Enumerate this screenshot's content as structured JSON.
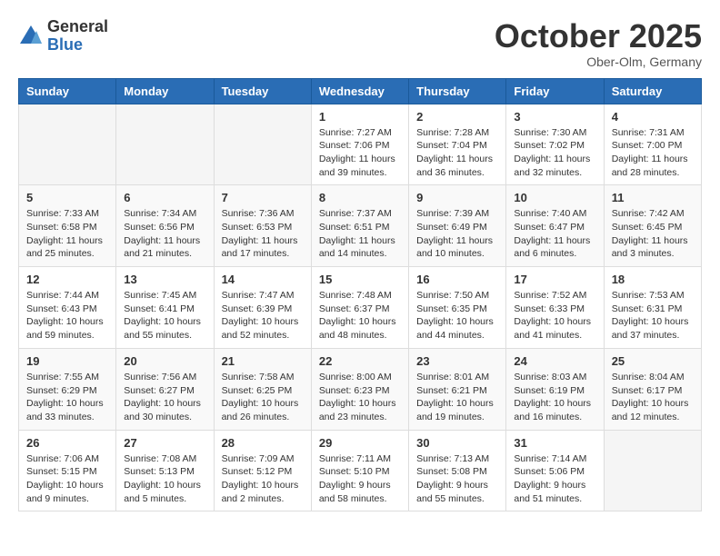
{
  "header": {
    "logo_line1": "General",
    "logo_line2": "Blue",
    "month": "October 2025",
    "location": "Ober-Olm, Germany"
  },
  "weekdays": [
    "Sunday",
    "Monday",
    "Tuesday",
    "Wednesday",
    "Thursday",
    "Friday",
    "Saturday"
  ],
  "weeks": [
    [
      {
        "day": "",
        "info": ""
      },
      {
        "day": "",
        "info": ""
      },
      {
        "day": "",
        "info": ""
      },
      {
        "day": "1",
        "info": "Sunrise: 7:27 AM\nSunset: 7:06 PM\nDaylight: 11 hours\nand 39 minutes."
      },
      {
        "day": "2",
        "info": "Sunrise: 7:28 AM\nSunset: 7:04 PM\nDaylight: 11 hours\nand 36 minutes."
      },
      {
        "day": "3",
        "info": "Sunrise: 7:30 AM\nSunset: 7:02 PM\nDaylight: 11 hours\nand 32 minutes."
      },
      {
        "day": "4",
        "info": "Sunrise: 7:31 AM\nSunset: 7:00 PM\nDaylight: 11 hours\nand 28 minutes."
      }
    ],
    [
      {
        "day": "5",
        "info": "Sunrise: 7:33 AM\nSunset: 6:58 PM\nDaylight: 11 hours\nand 25 minutes."
      },
      {
        "day": "6",
        "info": "Sunrise: 7:34 AM\nSunset: 6:56 PM\nDaylight: 11 hours\nand 21 minutes."
      },
      {
        "day": "7",
        "info": "Sunrise: 7:36 AM\nSunset: 6:53 PM\nDaylight: 11 hours\nand 17 minutes."
      },
      {
        "day": "8",
        "info": "Sunrise: 7:37 AM\nSunset: 6:51 PM\nDaylight: 11 hours\nand 14 minutes."
      },
      {
        "day": "9",
        "info": "Sunrise: 7:39 AM\nSunset: 6:49 PM\nDaylight: 11 hours\nand 10 minutes."
      },
      {
        "day": "10",
        "info": "Sunrise: 7:40 AM\nSunset: 6:47 PM\nDaylight: 11 hours\nand 6 minutes."
      },
      {
        "day": "11",
        "info": "Sunrise: 7:42 AM\nSunset: 6:45 PM\nDaylight: 11 hours\nand 3 minutes."
      }
    ],
    [
      {
        "day": "12",
        "info": "Sunrise: 7:44 AM\nSunset: 6:43 PM\nDaylight: 10 hours\nand 59 minutes."
      },
      {
        "day": "13",
        "info": "Sunrise: 7:45 AM\nSunset: 6:41 PM\nDaylight: 10 hours\nand 55 minutes."
      },
      {
        "day": "14",
        "info": "Sunrise: 7:47 AM\nSunset: 6:39 PM\nDaylight: 10 hours\nand 52 minutes."
      },
      {
        "day": "15",
        "info": "Sunrise: 7:48 AM\nSunset: 6:37 PM\nDaylight: 10 hours\nand 48 minutes."
      },
      {
        "day": "16",
        "info": "Sunrise: 7:50 AM\nSunset: 6:35 PM\nDaylight: 10 hours\nand 44 minutes."
      },
      {
        "day": "17",
        "info": "Sunrise: 7:52 AM\nSunset: 6:33 PM\nDaylight: 10 hours\nand 41 minutes."
      },
      {
        "day": "18",
        "info": "Sunrise: 7:53 AM\nSunset: 6:31 PM\nDaylight: 10 hours\nand 37 minutes."
      }
    ],
    [
      {
        "day": "19",
        "info": "Sunrise: 7:55 AM\nSunset: 6:29 PM\nDaylight: 10 hours\nand 33 minutes."
      },
      {
        "day": "20",
        "info": "Sunrise: 7:56 AM\nSunset: 6:27 PM\nDaylight: 10 hours\nand 30 minutes."
      },
      {
        "day": "21",
        "info": "Sunrise: 7:58 AM\nSunset: 6:25 PM\nDaylight: 10 hours\nand 26 minutes."
      },
      {
        "day": "22",
        "info": "Sunrise: 8:00 AM\nSunset: 6:23 PM\nDaylight: 10 hours\nand 23 minutes."
      },
      {
        "day": "23",
        "info": "Sunrise: 8:01 AM\nSunset: 6:21 PM\nDaylight: 10 hours\nand 19 minutes."
      },
      {
        "day": "24",
        "info": "Sunrise: 8:03 AM\nSunset: 6:19 PM\nDaylight: 10 hours\nand 16 minutes."
      },
      {
        "day": "25",
        "info": "Sunrise: 8:04 AM\nSunset: 6:17 PM\nDaylight: 10 hours\nand 12 minutes."
      }
    ],
    [
      {
        "day": "26",
        "info": "Sunrise: 7:06 AM\nSunset: 5:15 PM\nDaylight: 10 hours\nand 9 minutes."
      },
      {
        "day": "27",
        "info": "Sunrise: 7:08 AM\nSunset: 5:13 PM\nDaylight: 10 hours\nand 5 minutes."
      },
      {
        "day": "28",
        "info": "Sunrise: 7:09 AM\nSunset: 5:12 PM\nDaylight: 10 hours\nand 2 minutes."
      },
      {
        "day": "29",
        "info": "Sunrise: 7:11 AM\nSunset: 5:10 PM\nDaylight: 9 hours\nand 58 minutes."
      },
      {
        "day": "30",
        "info": "Sunrise: 7:13 AM\nSunset: 5:08 PM\nDaylight: 9 hours\nand 55 minutes."
      },
      {
        "day": "31",
        "info": "Sunrise: 7:14 AM\nSunset: 5:06 PM\nDaylight: 9 hours\nand 51 minutes."
      },
      {
        "day": "",
        "info": ""
      }
    ]
  ]
}
